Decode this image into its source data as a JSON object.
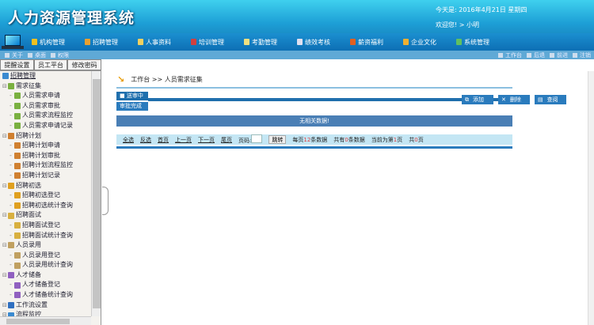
{
  "header": {
    "title": "人力资源管理系统",
    "date": "今天是: 2016年4月21日  星期四",
    "welcome": "欢迎您! > 小明"
  },
  "nav": [
    {
      "label": "机构管理",
      "color": "#f0c020"
    },
    {
      "label": "招聘管理",
      "color": "#e8a030"
    },
    {
      "label": "人事资料",
      "color": "#f0d060"
    },
    {
      "label": "培训管理",
      "color": "#d04040"
    },
    {
      "label": "考勤管理",
      "color": "#f0e080"
    },
    {
      "label": "绩效考核",
      "color": "#e0e0f0"
    },
    {
      "label": "薪资福利",
      "color": "#e06020"
    },
    {
      "label": "企业文化",
      "color": "#f0b030"
    },
    {
      "label": "系统管理",
      "color": "#60c060"
    }
  ],
  "subbar": {
    "left": [
      "关于",
      "桌面",
      "权限"
    ],
    "right": [
      "工作台",
      "后退",
      "前进",
      "注销"
    ]
  },
  "tabs": [
    "提醒设置",
    "员工平台",
    "修改密码"
  ],
  "tree": [
    {
      "label": "招聘管理",
      "level": 0
    },
    {
      "label": "需求征集",
      "level": 1
    },
    {
      "label": "人员需求申请",
      "level": 2
    },
    {
      "label": "人员需求审批",
      "level": 2
    },
    {
      "label": "人员需求流程监控",
      "level": 2
    },
    {
      "label": "人员需求申请记录",
      "level": 2
    },
    {
      "label": "招聘计划",
      "level": 1
    },
    {
      "label": "招聘计划申请",
      "level": 2
    },
    {
      "label": "招聘计划审批",
      "level": 2
    },
    {
      "label": "招聘计划流程监控",
      "level": 2
    },
    {
      "label": "招聘计划记录",
      "level": 2
    },
    {
      "label": "招聘初选",
      "level": 1
    },
    {
      "label": "招聘初选登记",
      "level": 2
    },
    {
      "label": "招聘初选统计查询",
      "level": 2
    },
    {
      "label": "招聘面试",
      "level": 1
    },
    {
      "label": "招聘面试登记",
      "level": 2
    },
    {
      "label": "招聘面试统计查询",
      "level": 2
    },
    {
      "label": "人员录用",
      "level": 1
    },
    {
      "label": "人员录用登记",
      "level": 2
    },
    {
      "label": "人员录用统计查询",
      "level": 2
    },
    {
      "label": "人才储备",
      "level": 1
    },
    {
      "label": "人才储备登记",
      "level": 2
    },
    {
      "label": "人才储备统计查询",
      "level": 2
    },
    {
      "label": "工作流设置",
      "level": 1
    },
    {
      "label": "流程监控",
      "level": 1
    }
  ],
  "main": {
    "breadcrumb": "工作台 >> 人员需求征集",
    "status_tabs": [
      "送审中",
      "审批完成"
    ],
    "buttons": [
      "添加",
      "删除",
      "查阅"
    ],
    "empty": "无相关数据!",
    "pager": {
      "select_all": "全选",
      "invert": "反选",
      "first": "首页",
      "prev": "上一页",
      "next": "下一页",
      "last": "尾页",
      "page_label": "页码:",
      "go": "跳转",
      "per_page_pre": "每页",
      "per_page": "12",
      "per_page_post": "条数据",
      "total_pre": "共有",
      "total": "0",
      "total_post": "条数据",
      "cur_pre": "当前为第",
      "cur": "1",
      "cur_post": "页",
      "pages_pre": "共",
      "pages": "0",
      "pages_post": "页"
    }
  }
}
